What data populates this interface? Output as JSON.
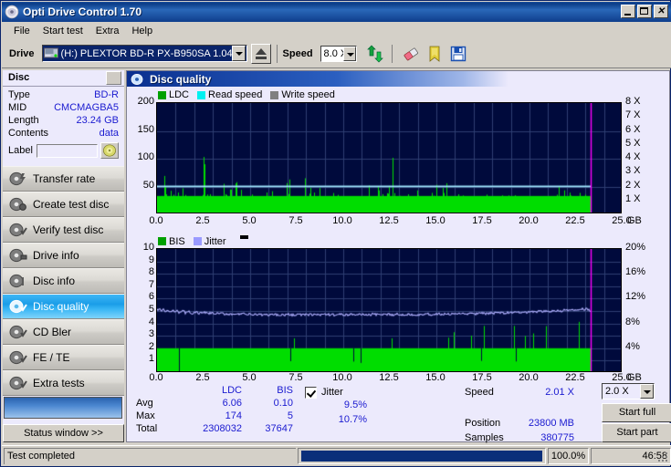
{
  "window": {
    "title": "Opti Drive Control 1.70",
    "icon": "disc-icon",
    "minimize": "_",
    "maximize": "□",
    "close": "✕"
  },
  "menubar": {
    "items": [
      "File",
      "Start test",
      "Extra",
      "Help"
    ]
  },
  "toolbar": {
    "drive_label": "Drive",
    "drive_value": "(H:)   PLEXTOR BD-R  PX-B950SA 1.04",
    "eject_icon": "eject-icon",
    "speed_label": "Speed",
    "speed_value": "8.0 X",
    "refresh_icon": "refresh-icon",
    "erase_icon": "eraser-icon",
    "bookmark_icon": "bookmark-icon",
    "save_icon": "save-icon"
  },
  "sidebar": {
    "disc_header": "Disc",
    "info": [
      {
        "key": "Type",
        "value": "BD-R"
      },
      {
        "key": "MID",
        "value": "CMCMAGBA5"
      },
      {
        "key": "Length",
        "value": "23.24 GB"
      },
      {
        "key": "Contents",
        "value": "data"
      }
    ],
    "label_key": "Label",
    "label_value": "",
    "label_placeholder": "",
    "nav": [
      {
        "label": "Transfer rate",
        "icon": "disc-transfer-icon",
        "selected": false
      },
      {
        "label": "Create test disc",
        "icon": "disc-create-icon",
        "selected": false
      },
      {
        "label": "Verify test disc",
        "icon": "disc-verify-icon",
        "selected": false
      },
      {
        "label": "Drive info",
        "icon": "disc-drive-icon",
        "selected": false
      },
      {
        "label": "Disc info",
        "icon": "disc-info-icon",
        "selected": false
      },
      {
        "label": "Disc quality",
        "icon": "disc-quality-icon",
        "selected": true
      },
      {
        "label": "CD Bler",
        "icon": "disc-bler-icon",
        "selected": false
      },
      {
        "label": "FE / TE",
        "icon": "disc-fete-icon",
        "selected": false
      },
      {
        "label": "Extra tests",
        "icon": "disc-extra-icon",
        "selected": false
      }
    ],
    "status_window_button": "Status window >>"
  },
  "main": {
    "header_title": "Disc quality",
    "header_icon": "disc-quality-icon"
  },
  "stats": {
    "columns": [
      "LDC",
      "BIS"
    ],
    "rows": [
      {
        "key": "Avg",
        "ldc": "6.06",
        "bis": "0.10"
      },
      {
        "key": "Max",
        "ldc": "174",
        "bis": "5"
      },
      {
        "key": "Total",
        "ldc": "2308032",
        "bis": "37647"
      }
    ],
    "jitter_label": "Jitter",
    "jitter_checked": true,
    "jitter_avg": "9.5%",
    "jitter_max": "10.7%"
  },
  "readout": {
    "speed_key": "Speed",
    "speed_value": "2.01 X",
    "position_key": "Position",
    "position_value": "23800 MB",
    "samples_key": "Samples",
    "samples_value": "380775",
    "speed_select": "2.0 X",
    "start_full": "Start full",
    "start_part": "Start part"
  },
  "statusbar": {
    "message": "Test completed",
    "percent": "100.0%",
    "elapsed": "46:58",
    "progress_fraction": 1.0
  },
  "colors": {
    "ldc": "#00dd00",
    "bis": "#00dd00",
    "read_speed": "#00ffff",
    "write_speed": "#808080",
    "jitter": "#9a9aff",
    "plot_bg": "#000a3c",
    "grid": "#3a4a7a",
    "end_marker": "#ff00ff",
    "title_blue": "#0a3c86",
    "value_blue": "#1a1ad0",
    "selected_nav": "#1a9de8"
  },
  "chart_data": [
    {
      "type": "area",
      "id": "ldc-chart",
      "title": "Disc quality",
      "xlabel": "GB",
      "ylabel": "",
      "xlim": [
        0,
        25
      ],
      "xticks": [
        "0.0",
        "2.5",
        "5.0",
        "7.5",
        "10.0",
        "12.5",
        "15.0",
        "17.5",
        "20.0",
        "22.5",
        "25.0"
      ],
      "ylim": [
        0,
        200
      ],
      "yticks": [
        "50",
        "100",
        "150",
        "200"
      ],
      "y2label": "X",
      "y2lim": [
        0,
        8
      ],
      "y2ticks": [
        "1 X",
        "2 X",
        "3 X",
        "4 X",
        "5 X",
        "6 X",
        "7 X",
        "8 X"
      ],
      "grid": true,
      "legend": [
        {
          "name": "LDC",
          "color": "#00cc00"
        },
        {
          "name": "Read speed",
          "color": "#00ffff"
        },
        {
          "name": "Write speed",
          "color": "#808080"
        }
      ],
      "data_end_gb": 23.3,
      "series": [
        {
          "name": "LDC",
          "kind": "spike-area",
          "baseline": 30,
          "avg": 6.06,
          "max": 174,
          "total": 2308032
        },
        {
          "name": "Read speed",
          "kind": "line",
          "value_x": 2.01
        }
      ],
      "ldc_samples": [
        38,
        24,
        30,
        46,
        62,
        93,
        40,
        28,
        33,
        50,
        26,
        40,
        22,
        30,
        44,
        26,
        35,
        20,
        28,
        44,
        30,
        25,
        38,
        22,
        35,
        28,
        24,
        48,
        40,
        30,
        26,
        39,
        160,
        44,
        68,
        30,
        40,
        26,
        34,
        22,
        28,
        44,
        30,
        38,
        24,
        31,
        27,
        42,
        30,
        26,
        72,
        38,
        27,
        40,
        76,
        33,
        25,
        44,
        30,
        28,
        35,
        26,
        41,
        30,
        24,
        38,
        27,
        46,
        30,
        25,
        40,
        28,
        36,
        22,
        30,
        44,
        26,
        38,
        31,
        27,
        52,
        30,
        24,
        41,
        36,
        28,
        44,
        30,
        26,
        93,
        40,
        30,
        27,
        38,
        25,
        46,
        30,
        22,
        35,
        60,
        28,
        41,
        30,
        24,
        38,
        67,
        30,
        26,
        44,
        31,
        27,
        36,
        57,
        30,
        25,
        40,
        28,
        46,
        30,
        23,
        38,
        61,
        30,
        27,
        42,
        30,
        25,
        38,
        44,
        30,
        26,
        58,
        31,
        27,
        40,
        36,
        30,
        24,
        44,
        30,
        28,
        38,
        46,
        30,
        25,
        39,
        30,
        27,
        42,
        30,
        24,
        36,
        82,
        30,
        26,
        44,
        30,
        28,
        38,
        79,
        31,
        27,
        160,
        44,
        30,
        26,
        40,
        36,
        30,
        25,
        60,
        30,
        28,
        42,
        31,
        27,
        38,
        44,
        30,
        26,
        36,
        30,
        24,
        46,
        30,
        28,
        40,
        31,
        27,
        54,
        36,
        30,
        25,
        44,
        30,
        26,
        38,
        66,
        30,
        28,
        42,
        31,
        24,
        36,
        30,
        27,
        44,
        40,
        30,
        26,
        38,
        30,
        25,
        46,
        31,
        28,
        40,
        30,
        24,
        36,
        44,
        30,
        27,
        38,
        62,
        30,
        25,
        42,
        30,
        28,
        36,
        31,
        26,
        44,
        40,
        30,
        24,
        38,
        46,
        30,
        28,
        31,
        36,
        30,
        25,
        42,
        44,
        30,
        27,
        38,
        30,
        24,
        46,
        31,
        28,
        40,
        36,
        30,
        26,
        44,
        30,
        25,
        38,
        42,
        30,
        27,
        31,
        36,
        46,
        30,
        24,
        40,
        30,
        28,
        38,
        44,
        30,
        26,
        42,
        31,
        25,
        36,
        30,
        27,
        46,
        40,
        30,
        24,
        38,
        30,
        28,
        44,
        31,
        26,
        36,
        42,
        30,
        25,
        40,
        46
      ]
    },
    {
      "type": "area",
      "id": "bis-chart",
      "xlabel": "GB",
      "xlim": [
        0,
        25
      ],
      "xticks": [
        "0.0",
        "2.5",
        "5.0",
        "7.5",
        "10.0",
        "12.5",
        "15.0",
        "17.5",
        "20.0",
        "22.5",
        "25.0"
      ],
      "ylim": [
        0,
        10
      ],
      "yticks": [
        "1",
        "2",
        "3",
        "4",
        "5",
        "6",
        "7",
        "8",
        "9",
        "10"
      ],
      "y2lim": [
        0,
        20
      ],
      "y2ticks": [
        "4%",
        "8%",
        "12%",
        "16%",
        "20%"
      ],
      "grid": true,
      "legend": [
        {
          "name": "BIS",
          "color": "#00cc00"
        },
        {
          "name": "Jitter",
          "color": "#9a9aff"
        }
      ],
      "data_end_gb": 23.3,
      "series": [
        {
          "name": "BIS",
          "kind": "spike-area",
          "baseline": 2,
          "avg": 0.1,
          "max": 5,
          "total": 37647
        },
        {
          "name": "Jitter",
          "kind": "line",
          "avg_pct": 9.5,
          "max_pct": 10.7
        }
      ],
      "bis_samples": [
        2,
        2,
        3,
        2,
        2,
        1,
        2,
        2,
        3,
        2,
        2,
        2,
        1,
        2,
        3,
        2,
        2,
        2,
        2,
        1,
        2,
        3,
        2,
        2,
        2,
        2,
        3,
        2,
        1,
        2,
        2,
        2,
        3,
        2,
        2,
        4,
        2,
        3,
        2,
        2,
        1,
        2,
        2,
        3,
        2,
        1,
        2,
        2,
        2,
        3,
        2,
        2,
        1,
        2,
        2,
        2,
        3,
        2,
        2,
        2,
        1,
        2,
        3,
        2,
        2,
        2,
        3,
        2,
        1,
        2,
        2,
        3,
        2,
        2,
        2,
        1,
        3,
        2,
        2,
        2,
        3,
        2,
        2,
        1,
        2,
        2,
        3,
        2,
        2,
        2,
        1,
        2,
        2,
        3,
        2,
        2,
        2,
        1,
        2,
        3,
        2,
        2,
        2,
        3,
        2,
        1,
        2,
        2,
        2,
        3,
        2,
        2,
        1,
        2,
        3,
        2,
        2,
        2,
        2,
        1,
        2,
        3,
        2,
        2,
        2,
        2,
        3,
        1,
        2,
        2,
        4,
        2,
        3,
        2,
        2,
        1,
        2,
        2,
        3,
        2,
        2,
        2,
        1,
        2,
        3,
        2,
        2,
        2,
        2,
        3,
        1,
        2,
        2,
        2,
        3,
        2,
        1,
        2,
        2,
        3,
        2,
        2,
        2,
        1,
        3,
        2,
        2,
        4,
        2,
        2,
        3,
        2,
        1,
        2,
        2,
        2,
        3,
        2,
        2,
        1,
        2,
        3,
        2,
        2,
        2,
        2,
        1,
        3,
        2,
        2,
        2,
        3,
        2,
        1,
        2,
        2,
        3,
        2,
        2,
        2,
        1,
        2,
        3,
        2,
        2,
        2,
        3,
        2,
        1,
        2,
        3,
        2,
        2,
        2,
        2,
        3,
        1,
        2,
        2,
        3,
        2,
        2,
        2,
        1,
        2,
        3,
        2,
        2,
        2,
        2,
        1,
        3,
        2,
        2,
        4,
        2,
        3,
        2,
        2,
        1,
        2,
        2,
        3,
        2,
        2,
        2,
        3,
        1,
        2,
        2,
        2,
        3,
        2,
        1,
        4,
        2,
        3,
        2,
        2,
        2,
        1,
        2,
        3,
        2,
        2,
        4,
        2,
        3,
        2,
        2,
        1,
        2,
        2,
        3,
        2,
        2,
        4,
        2,
        3,
        2,
        2,
        1,
        2,
        3,
        2,
        2,
        4,
        2,
        2,
        3,
        1,
        2,
        2,
        2,
        3,
        2,
        4,
        2,
        2,
        2
      ],
      "jitter_samples": [
        5.1,
        5.2,
        5.0,
        5.1,
        4.95,
        5.05,
        4.9,
        5.0,
        4.95,
        5.1,
        4.9,
        4.95,
        5.0,
        4.85,
        4.9,
        4.95,
        4.8,
        4.85,
        4.9,
        4.8,
        4.85,
        4.8,
        4.9,
        4.82,
        4.78,
        4.85,
        4.8,
        4.75,
        4.82,
        4.78,
        4.8,
        4.75,
        4.8,
        4.72,
        4.78,
        4.75,
        4.8,
        4.7,
        4.75,
        4.72,
        4.78,
        4.7,
        4.75,
        4.72,
        4.68,
        4.75,
        4.7,
        4.72,
        4.68,
        4.7,
        4.72,
        4.68,
        4.72,
        4.7,
        4.75,
        4.68,
        4.7,
        4.72,
        4.68,
        4.7,
        4.72,
        4.7,
        4.68,
        4.72,
        4.7,
        4.75,
        4.68,
        4.72,
        4.7,
        4.68,
        4.72,
        4.7,
        4.75,
        4.68,
        4.7,
        4.72,
        4.68,
        4.7,
        4.75,
        4.7,
        4.72,
        4.68,
        4.7,
        4.72,
        4.75,
        4.7,
        4.68,
        4.72,
        4.7,
        4.75,
        4.72,
        4.7,
        4.68,
        4.72,
        4.75,
        4.7,
        4.72,
        4.68,
        4.7,
        4.75,
        4.72,
        4.7,
        4.75,
        4.72,
        4.68,
        4.7,
        4.72,
        4.75,
        4.7,
        4.72,
        4.75,
        4.7,
        4.72,
        4.68,
        4.7,
        4.75,
        4.72,
        4.7,
        4.75,
        4.72,
        4.7,
        4.75,
        4.72,
        4.78,
        4.75,
        4.72,
        4.7,
        4.75,
        4.72,
        4.78,
        4.75,
        4.72,
        4.75,
        4.78,
        4.72,
        4.75,
        4.78,
        4.75,
        4.72,
        4.78,
        4.75,
        4.8,
        4.78,
        4.75,
        4.82,
        4.78,
        4.75,
        4.8,
        4.78,
        4.82,
        4.8,
        4.78,
        4.82,
        4.85,
        4.8,
        4.82,
        4.85,
        4.8,
        4.88,
        4.85,
        4.82,
        4.88,
        4.85,
        4.9,
        4.88,
        4.85,
        4.9,
        4.88,
        4.92,
        4.9,
        4.88,
        4.92,
        4.95,
        4.9,
        4.92,
        4.98,
        4.95,
        4.92,
        5.0,
        4.98,
        4.95,
        5.02,
        5.0,
        4.98,
        5.05,
        5.02,
        5.0,
        5.08,
        5.05,
        5.02,
        5.1,
        5.08,
        5.05,
        5.12,
        5.1,
        5.15,
        5.12,
        5.2,
        5.1,
        5.0
      ]
    }
  ]
}
